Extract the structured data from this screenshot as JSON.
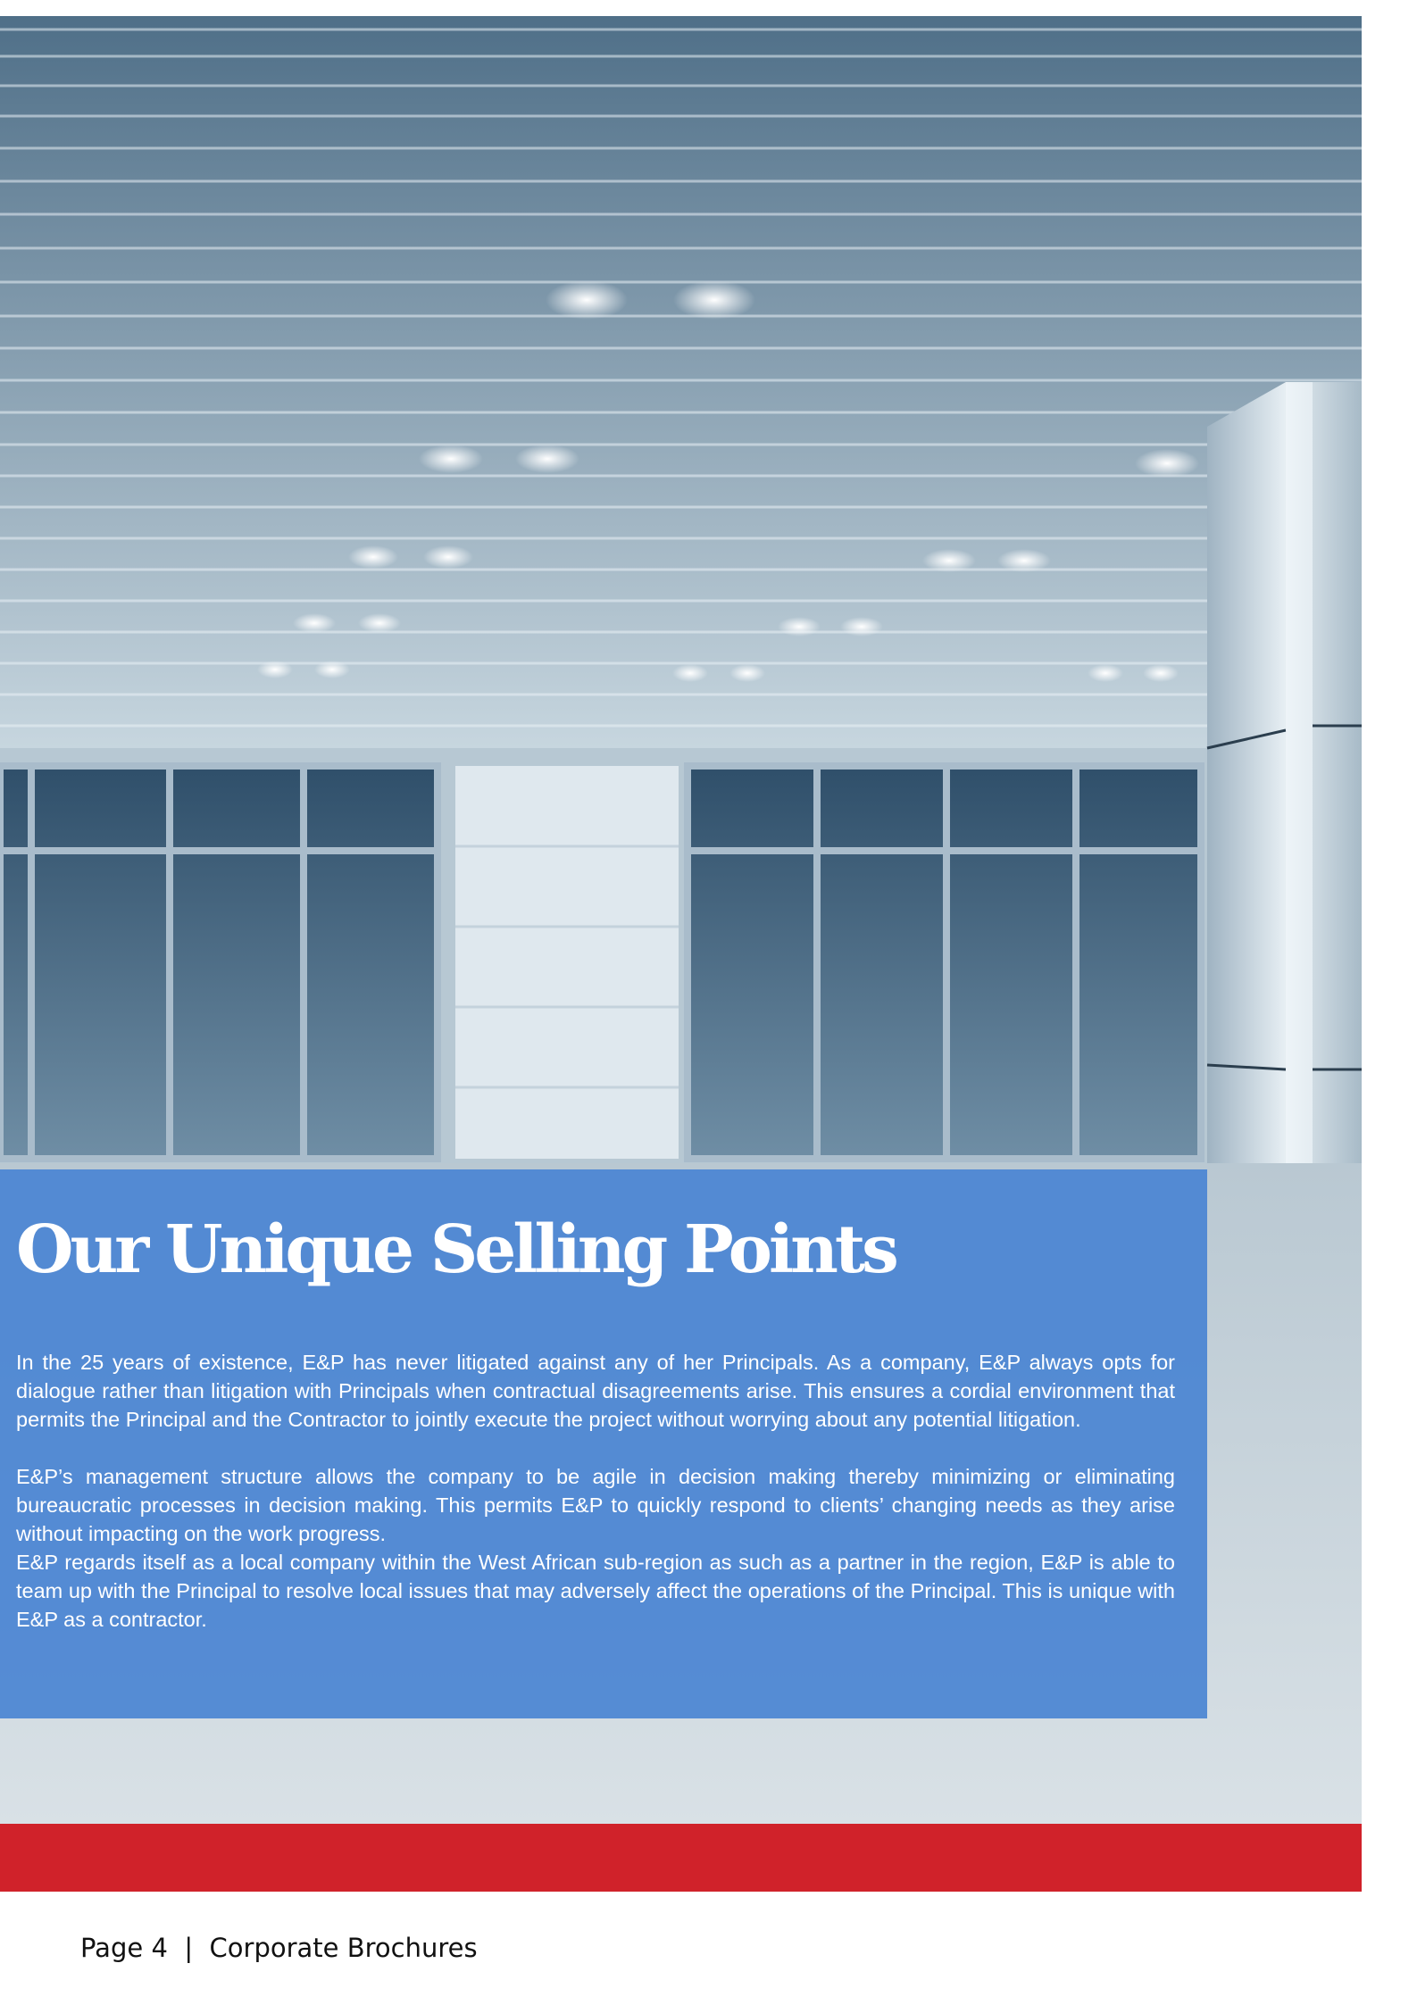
{
  "section": {
    "title": "Our Unique Selling Points",
    "paragraphs": [
      "In the 25 years of existence, E&P has never litigated against any of her Principals. As a company, E&P always opts for dialogue rather than litigation with Principals when contractual disagreements arise. This ensures a cordial environment that permits the Principal and the Contractor to jointly execute the project without worrying about any potential litigation.",
      "E&P’s management structure allows the company to be agile in decision making thereby minimizing or eliminating bureaucratic processes in decision making. This permits E&P to quickly respond to clients’ changing needs as they arise without impacting on the work progress.",
      "E&P regards itself as a local company within the West African sub-region as such as a partner in the region, E&P is able to team up with the Principal to resolve local issues that may adversely affect the operations of the Principal. This is unique with E&P as a contractor."
    ]
  },
  "footer": {
    "page_label": "Page",
    "page_number": "4",
    "separator": "|",
    "document_name": "Corporate Brochures"
  },
  "colors": {
    "panel_blue": "#4a84d2",
    "brand_red": "#d0222a"
  }
}
